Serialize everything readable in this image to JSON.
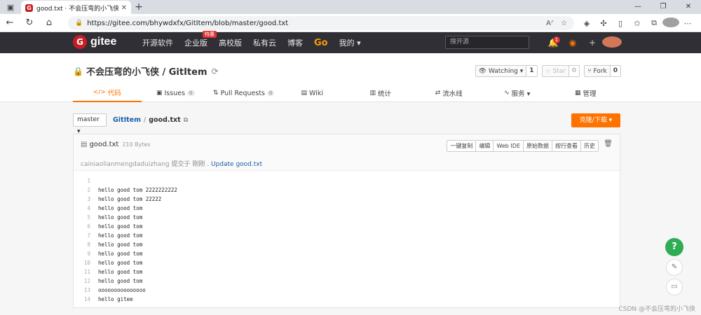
{
  "browser": {
    "tab_title": "good.txt · 不会压弯的小飞侠/Gitl",
    "url": "https://gitee.com/bhywdxfx/GitItem/blob/master/good.txt",
    "menu_icon": "tab-menu-icon"
  },
  "gitee_nav": {
    "logo_text": "gitee",
    "menu": [
      {
        "label": "开源软件"
      },
      {
        "label": "企业版",
        "badge": "特惠"
      },
      {
        "label": "高校版"
      },
      {
        "label": "私有云"
      },
      {
        "label": "博客"
      },
      {
        "label": "Go"
      },
      {
        "label": "我的 ▾"
      }
    ],
    "search_placeholder": "搜开源",
    "notify_count": "1"
  },
  "repo": {
    "owner": "不会压弯的小飞侠",
    "name": "GitItem",
    "title": "不会压弯的小飞侠 / GitItem",
    "watching_label": "Watching ▾",
    "watching_count": "1",
    "star_label": "Star",
    "star_count": "0",
    "fork_label": "Fork",
    "fork_count": "0",
    "tabs": [
      {
        "label": "代码",
        "icon": "</>",
        "active": true
      },
      {
        "label": "Issues",
        "icon": "▣",
        "count": "0"
      },
      {
        "label": "Pull Requests",
        "icon": "⇅",
        "count": "0"
      },
      {
        "label": "Wiki",
        "icon": "▤"
      },
      {
        "label": "统计",
        "icon": "▥"
      },
      {
        "label": "流水线",
        "icon": "⇄"
      },
      {
        "label": "服务 ▾",
        "icon": "∿"
      },
      {
        "label": "管理",
        "icon": "▦"
      }
    ]
  },
  "branch": {
    "selected": "master ▾",
    "breadcrumb_repo": "GitItem",
    "breadcrumb_sep": "/",
    "breadcrumb_file": "good.txt",
    "clone_label": "克隆/下载 ▾"
  },
  "file": {
    "name": "good.txt",
    "size": "210 Bytes",
    "tools": [
      "一键复制",
      "编辑",
      "Web IDE",
      "原始数据",
      "按行查看",
      "历史"
    ],
    "commit_author": "cainiaolianmengdaduizhang",
    "commit_time": "提交于 刚刚 .",
    "commit_msg": "Update good.txt",
    "lines": [
      {
        "no": "1",
        "text": ""
      },
      {
        "no": "2",
        "text": "hello good tom 2222222222"
      },
      {
        "no": "3",
        "text": "hello good tom 22222"
      },
      {
        "no": "4",
        "text": "hello good tom"
      },
      {
        "no": "5",
        "text": "hello good tom"
      },
      {
        "no": "6",
        "text": "hello good tom"
      },
      {
        "no": "7",
        "text": "hello good tom"
      },
      {
        "no": "8",
        "text": "hello good tom"
      },
      {
        "no": "9",
        "text": "hello good tom"
      },
      {
        "no": "10",
        "text": "hello good tom"
      },
      {
        "no": "11",
        "text": "hello good tom"
      },
      {
        "no": "12",
        "text": "hello good tom"
      },
      {
        "no": "13",
        "text": "ooooooooooooooo"
      },
      {
        "no": "14",
        "text": "hello gitee"
      }
    ]
  },
  "floating": {
    "help_label": "?"
  },
  "watermark": "CSDN @不会压弯的小飞侠"
}
